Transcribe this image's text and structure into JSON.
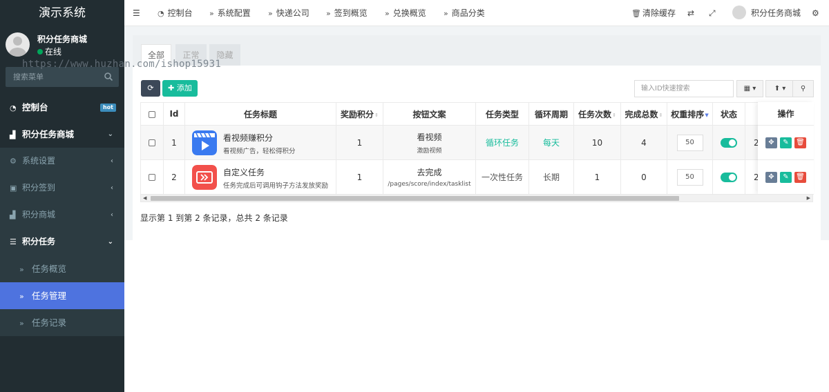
{
  "app_title": "演示系统",
  "user": {
    "name": "积分任务商城",
    "status": "在线"
  },
  "sidebar_search": {
    "placeholder": "搜索菜单"
  },
  "sidebar": {
    "dashboard": "控制台",
    "hot_badge": "hot",
    "shop": "积分任务商城",
    "system_settings": "系统设置",
    "checkin": "积分签到",
    "mall": "积分商城",
    "tasks": "积分任务",
    "task_overview": "任务概览",
    "task_manage": "任务管理",
    "task_records": "任务记录"
  },
  "topnav": {
    "items": [
      "控制台",
      "系统配置",
      "快递公司",
      "签到概览",
      "兑换概览",
      "商品分类"
    ],
    "clear_cache": "清除缓存",
    "user_name": "积分任务商城"
  },
  "tabs": [
    "全部",
    "正常",
    "隐藏"
  ],
  "watermark": "https://www.huzhan.com/ishop15931",
  "toolbar": {
    "add_label": "添加",
    "search_placeholder": "输入ID快速搜索"
  },
  "table": {
    "headers": [
      "Id",
      "任务标题",
      "奖励积分",
      "按钮文案",
      "任务类型",
      "循环周期",
      "任务次数",
      "完成总数",
      "权重排序",
      "状态"
    ],
    "ops_header": "操作",
    "rows": [
      {
        "id": "1",
        "title": "看视频赚积分",
        "desc": "看视频广告，轻松得积分",
        "points": "1",
        "btn_text": "看视频",
        "btn_sub": "激励视频",
        "type": "循环任务",
        "cycle": "每天",
        "times": "10",
        "completed": "4",
        "weight": "50",
        "extra": "2"
      },
      {
        "id": "2",
        "title": "自定义任务",
        "desc": "任务完成后可调用钩子方法发放奖励",
        "points": "1",
        "btn_text": "去完成",
        "btn_sub": "/pages/score/index/tasklist",
        "type": "一次性任务",
        "cycle": "长期",
        "times": "1",
        "completed": "0",
        "weight": "50",
        "extra": "2"
      }
    ]
  },
  "summary": "显示第 1 到第 2 条记录，总共 2 条记录",
  "colors": {
    "sidebar_bg": "#222d32",
    "accent": "#4e73df",
    "green": "#18bc9c",
    "danger": "#e74c3c"
  }
}
